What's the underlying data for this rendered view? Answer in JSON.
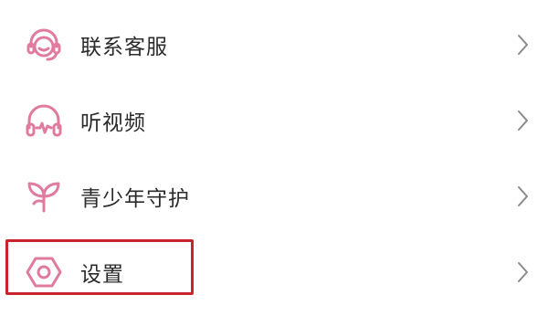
{
  "menu": {
    "items": [
      {
        "label": "联系客服",
        "icon": "headset-icon"
      },
      {
        "label": "听视频",
        "icon": "headphones-icon"
      },
      {
        "label": "青少年守护",
        "icon": "sprout-icon"
      },
      {
        "label": "设置",
        "icon": "settings-icon"
      }
    ]
  },
  "colors": {
    "icon_accent": "#e07a9e",
    "chevron": "#8a8a8a",
    "text": "#2b2b2b",
    "highlight_border": "#c8242b",
    "background": "#ffffff"
  }
}
